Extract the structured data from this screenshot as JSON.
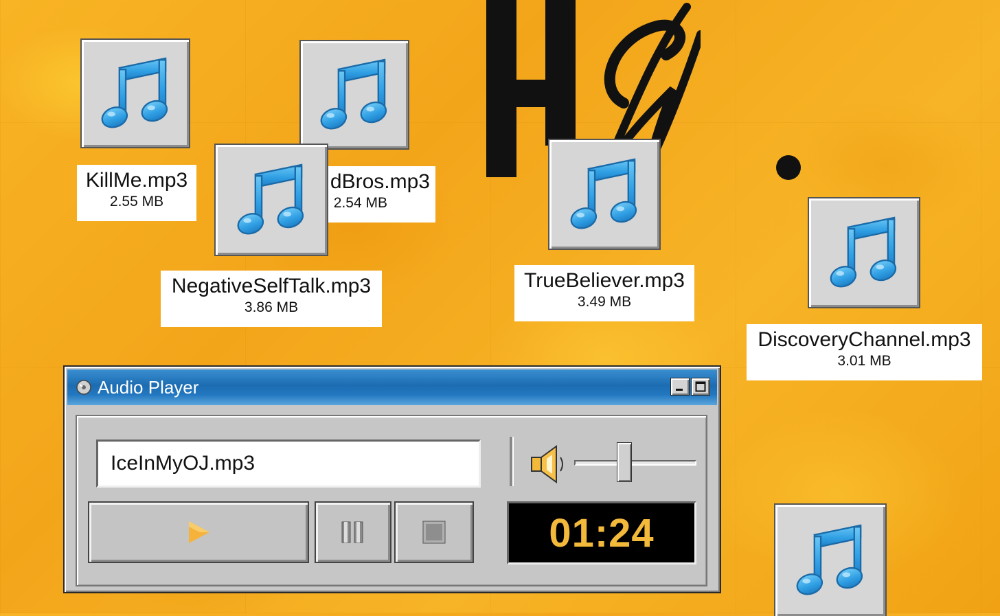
{
  "desktop": {
    "files": [
      {
        "name": "KillMe.mp3",
        "size": "2.55 MB"
      },
      {
        "name": "dBros.mp3",
        "size": "2.54 MB"
      },
      {
        "name": "NegativeSelfTalk.mp3",
        "size": "3.86 MB"
      },
      {
        "name": "TrueBeliever.mp3",
        "size": "3.49 MB"
      },
      {
        "name": "DiscoveryChannel.mp3",
        "size": "3.01 MB"
      }
    ],
    "icon": "music-note-icon",
    "logo_letters": "H W."
  },
  "player": {
    "title": "Audio Player",
    "title_icon": "cd-icon",
    "track": "IceInMyOJ.mp3",
    "time": "01:24",
    "volume": 0.4,
    "buttons": {
      "play": "play-icon",
      "pause": "pause-icon",
      "stop": "stop-icon"
    },
    "colors": {
      "accent": "#f2b93a",
      "titlebar": "#1c6cb2",
      "desktop": "#f5ad20"
    }
  }
}
